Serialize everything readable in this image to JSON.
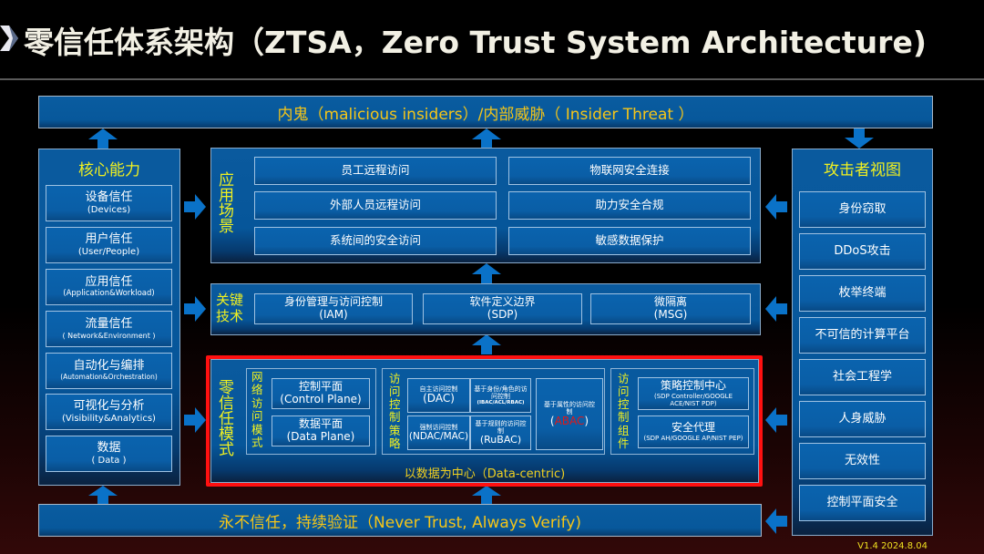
{
  "title": "零信任体系架构（ZTSA，Zero Trust System Architecture)",
  "top_banner": "内鬼（malicious insiders）/内部威胁（ Insider Threat ）",
  "bottom_banner": "永不信任，持续验证（Never Trust, Always Verify)",
  "left_panel": {
    "header": "核心能力",
    "items": [
      {
        "cn": "设备信任",
        "en": "(Devices)"
      },
      {
        "cn": "用户信任",
        "en": "(User/People)"
      },
      {
        "cn": "应用信任",
        "en": "(Application&Workload)"
      },
      {
        "cn": "流量信任",
        "en": "( Network&Environment )"
      },
      {
        "cn": "自动化与编排",
        "en": "(Automation&Orchestration)"
      },
      {
        "cn": "可视化与分析",
        "en": "(Visibility&Analytics)"
      },
      {
        "cn": "数据",
        "en": "( Data )"
      }
    ]
  },
  "right_panel": {
    "header": "攻击者视图",
    "items": [
      "身份窃取",
      "DDoS攻击",
      "枚举终端",
      "不可信的计算平台",
      "社会工程学",
      "人身威胁",
      "无效性",
      "控制平面安全"
    ]
  },
  "scenarios": {
    "label": [
      "应",
      "用",
      "场",
      "景"
    ],
    "items": [
      "员工远程访问",
      "物联网安全连接",
      "外部人员远程访问",
      "助力安全合规",
      "系统间的安全访问",
      "敏感数据保护"
    ]
  },
  "key_tech": {
    "label": [
      "关键",
      "技术"
    ],
    "items": [
      {
        "cn": "身份管理与访问控制",
        "en": "(IAM)"
      },
      {
        "cn": "软件定义边界",
        "en": "(SDP)"
      },
      {
        "cn": "微隔离",
        "en": "(MSG)"
      }
    ]
  },
  "zt_mode": {
    "label": [
      "零",
      "信",
      "任",
      "模",
      "式"
    ],
    "footer": "以数据为中心（Data-centric)",
    "network_access": {
      "label": [
        "网",
        "络",
        "访",
        "问",
        "模",
        "式"
      ],
      "items": [
        {
          "cn": "控制平面",
          "en": "(Control Plane)"
        },
        {
          "cn": "数据平面",
          "en": "(Data Plane)"
        }
      ]
    },
    "access_policy": {
      "label": [
        "访",
        "问",
        "控",
        "制",
        "策",
        "略"
      ],
      "dac": {
        "cn": "自主访问控制",
        "en": "(DAC)"
      },
      "ibac": {
        "cn": "基于身份/角色的访问控制",
        "en": "(IBAC/ACL/RBAC)"
      },
      "ndac": {
        "cn": "强制访问控制",
        "en": "(NDAC/MAC)"
      },
      "rubac": {
        "cn": "基于规则的访问控制",
        "en": "(RuBAC)"
      },
      "abac": {
        "cn": "基于属性的访问控制",
        "open": "(",
        "en": "ABAC",
        "close": ")"
      }
    },
    "access_components": {
      "label": [
        "访",
        "问",
        "控",
        "制",
        "组",
        "件"
      ],
      "items": [
        {
          "cn": "策略控制中心",
          "en": "(SDP Controller/GOOGLE ACE/NIST PDP)"
        },
        {
          "cn": "安全代理",
          "en": "(SDP AH/GOOGLE AP/NIST PEP)"
        }
      ]
    }
  },
  "version": "V1.4 2024.8.04",
  "colors": {
    "panel_blue": "#07589b",
    "accent_yellow": "#f0f020",
    "banner_text": "#f5c518",
    "highlight_red": "#ff1010",
    "arrow_blue": "#0a72c8"
  }
}
